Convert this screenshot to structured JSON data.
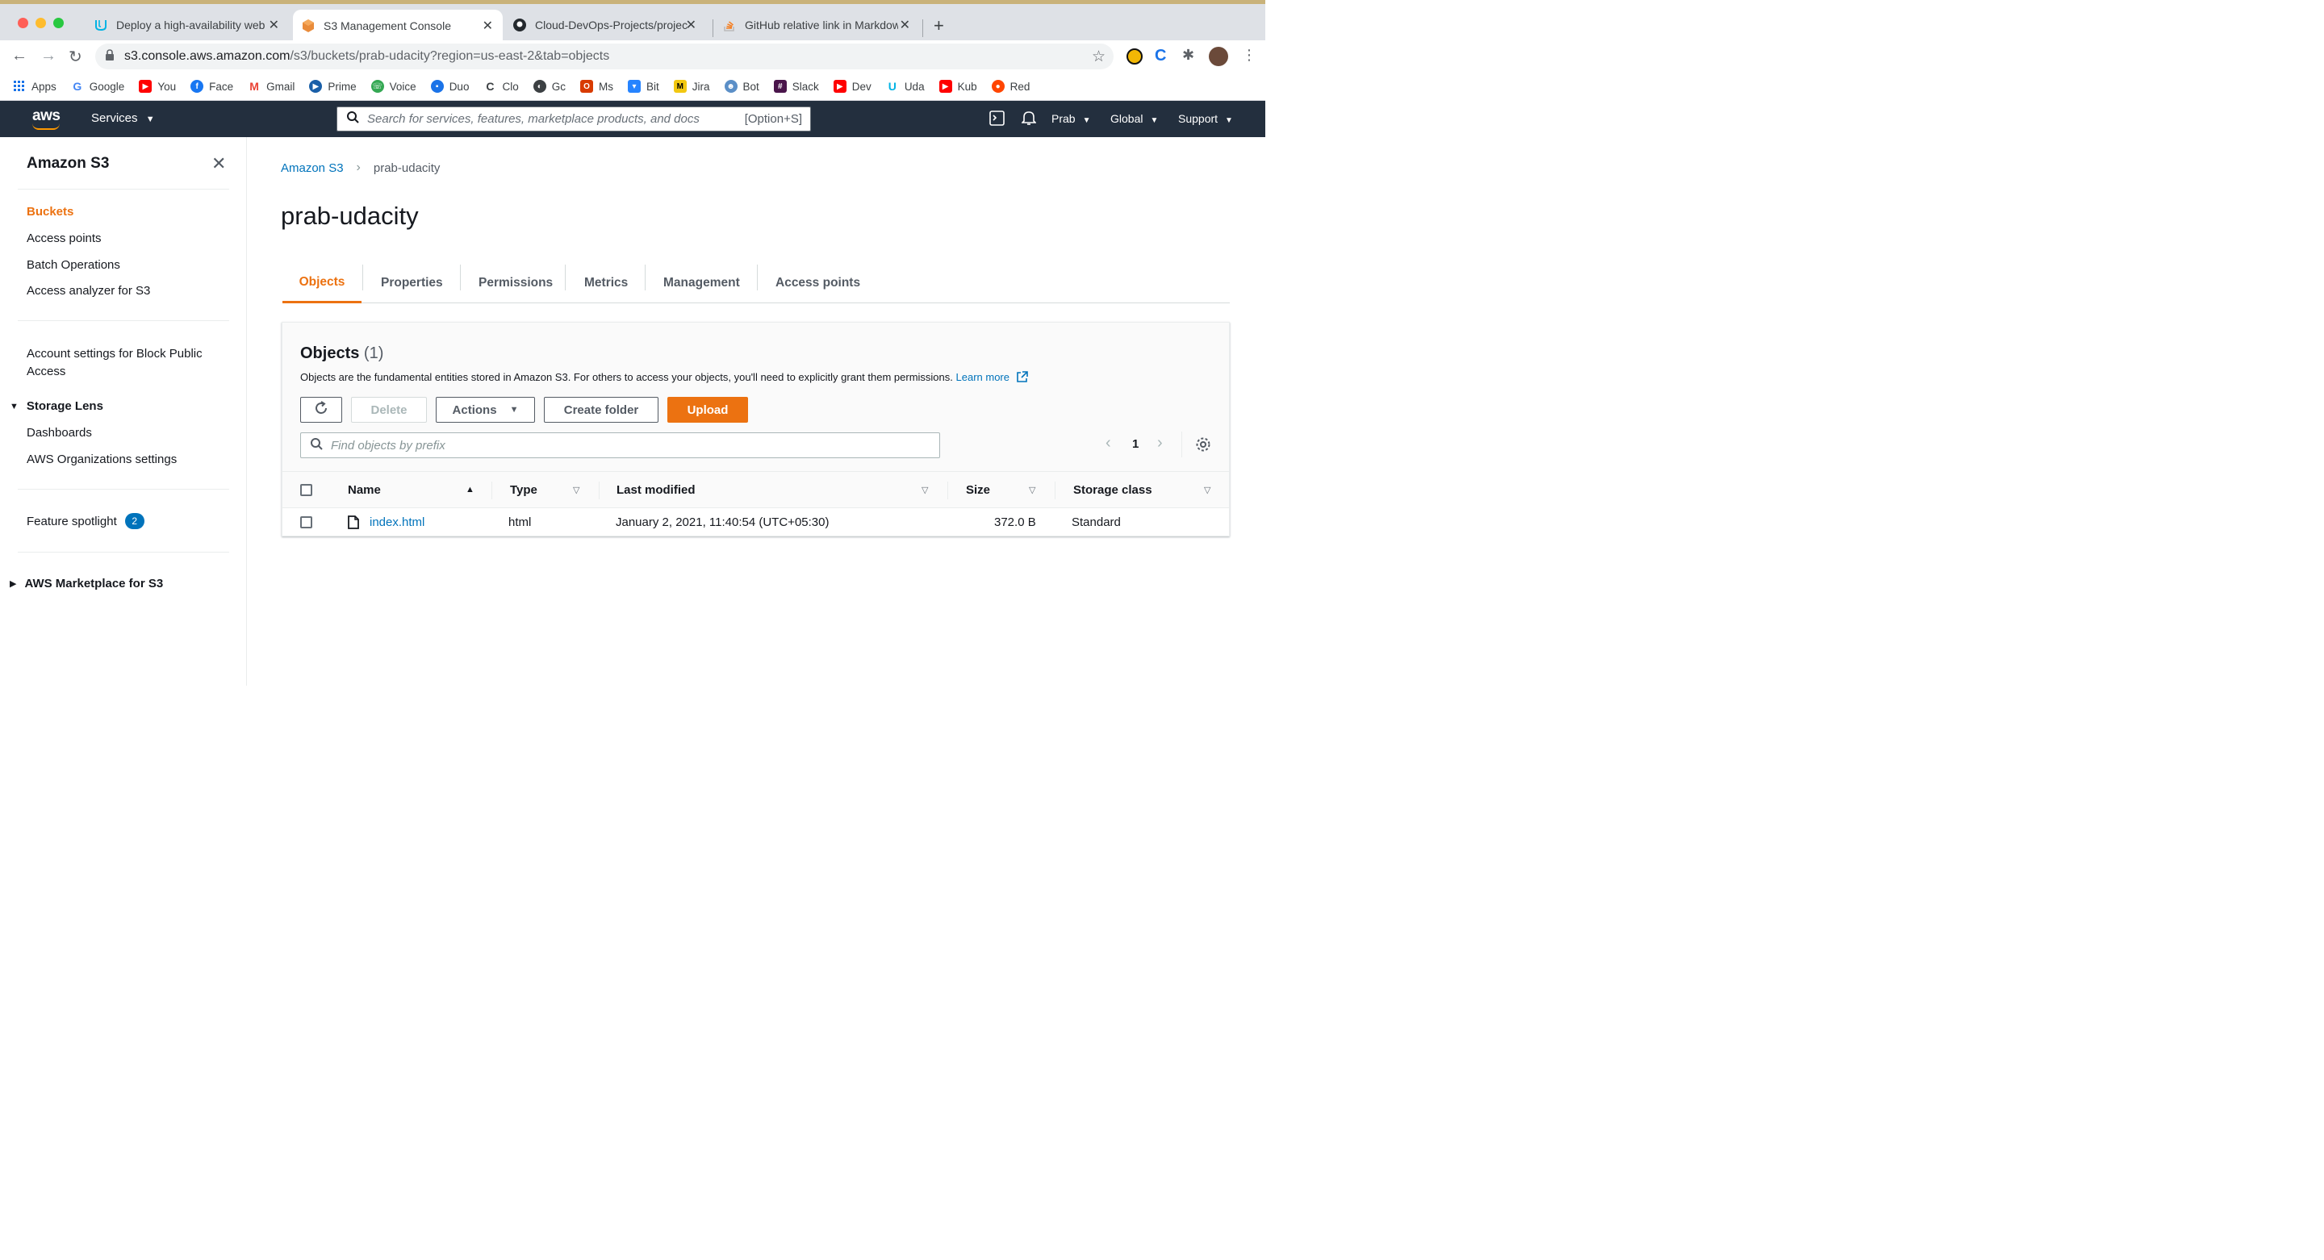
{
  "browser": {
    "tabs": [
      {
        "title": "Deploy a high-availability web a",
        "icon": "udacity-icon"
      },
      {
        "title": "S3 Management Console",
        "icon": "aws-s3-icon"
      },
      {
        "title": "Cloud-DevOps-Projects/projec",
        "icon": "github-icon"
      },
      {
        "title": "GitHub relative link in Markdow",
        "icon": "stackoverflow-icon"
      }
    ],
    "url_host": "s3.console.aws.amazon.com",
    "url_rest": "/s3/buckets/prab-udacity?region=us-east-2&tab=objects",
    "bookmarks": [
      "Apps",
      "Google",
      "You",
      "Face",
      "Gmail",
      "Prime",
      "Voice",
      "Duo",
      "Clo",
      "Gc",
      "Ms",
      "Bit",
      "Jira",
      "Bot",
      "Slack",
      "Dev",
      "Uda",
      "Kub",
      "Red"
    ]
  },
  "aws_nav": {
    "logo": "aws",
    "services": "Services",
    "search_placeholder": "Search for services, features, marketplace products, and docs",
    "search_shortcut": "[Option+S]",
    "user": "Prab",
    "region": "Global",
    "support": "Support"
  },
  "sidebar": {
    "title": "Amazon S3",
    "items": [
      "Buckets",
      "Access points",
      "Batch Operations",
      "Access analyzer for S3"
    ],
    "account_settings_line1": "Account settings for Block Public",
    "account_settings_line2": "Access",
    "storage_lens": "Storage Lens",
    "storage_lens_items": [
      "Dashboards",
      "AWS Organizations settings"
    ],
    "feature_spotlight": "Feature spotlight",
    "feature_spotlight_count": "2",
    "marketplace": "AWS Marketplace for S3"
  },
  "breadcrumb": {
    "root": "Amazon S3",
    "current": "prab-udacity"
  },
  "page_title": "prab-udacity",
  "tabs": [
    "Objects",
    "Properties",
    "Permissions",
    "Metrics",
    "Management",
    "Access points"
  ],
  "objects_panel": {
    "title": "Objects",
    "count": "(1)",
    "description": "Objects are the fundamental entities stored in Amazon S3. For others to access your objects, you'll need to explicitly grant them permissions.",
    "learn_more": "Learn more",
    "buttons": {
      "delete": "Delete",
      "actions": "Actions",
      "create_folder": "Create folder",
      "upload": "Upload"
    },
    "find_placeholder": "Find objects by prefix",
    "page": "1",
    "columns": [
      "Name",
      "Type",
      "Last modified",
      "Size",
      "Storage class"
    ],
    "rows": [
      {
        "name": "index.html",
        "type": "html",
        "last_modified": "January 2, 2021, 11:40:54 (UTC+05:30)",
        "size": "372.0 B",
        "storage_class": "Standard"
      }
    ]
  },
  "colors": {
    "accent": "#ec7211",
    "link": "#0073bb",
    "nav_bg": "#232f3e"
  }
}
